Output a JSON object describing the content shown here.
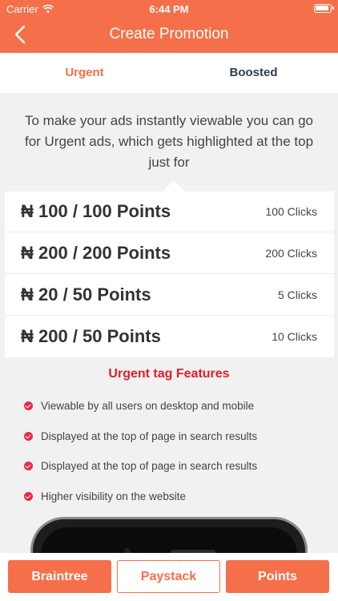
{
  "status_bar": {
    "carrier": "Carrier",
    "time": "6:44 PM"
  },
  "header": {
    "title": "Create Promotion",
    "back_icon": "chevron-left-icon"
  },
  "tabs": [
    {
      "label": "Urgent",
      "active": true
    },
    {
      "label": "Boosted",
      "active": false
    }
  ],
  "intro_text": "To make your ads instantly viewable you can go for Urgent ads, which gets highlighted at the top just for",
  "options": [
    {
      "price": "₦ 100 / 100 Points",
      "clicks": "100 Clicks"
    },
    {
      "price": "₦ 200 / 200 Points",
      "clicks": "200 Clicks"
    },
    {
      "price": "₦ 20 / 50 Points",
      "clicks": "5 Clicks"
    },
    {
      "price": "₦ 200 / 50 Points",
      "clicks": "10 Clicks"
    }
  ],
  "features": {
    "title": "Urgent tag Features",
    "items": [
      "Viewable by all users on desktop and mobile",
      "Displayed at the top of page in search results",
      "Displayed at the top of page in search results",
      "Higher visibility on the website"
    ]
  },
  "payment_buttons": {
    "braintree": "Braintree",
    "paystack": "Paystack",
    "points": "Points"
  },
  "colors": {
    "accent": "#f5704a",
    "feature_title": "#e01f26",
    "check": "#e8294a",
    "tab_inactive": "#2e3e4e"
  }
}
